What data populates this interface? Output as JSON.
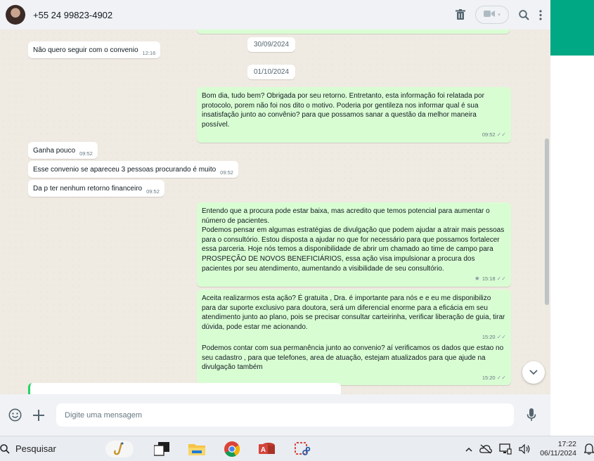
{
  "header": {
    "contact_name": "+55 24 99823-4902"
  },
  "chat": {
    "date_chips": [
      "30/09/2024",
      "01/10/2024"
    ],
    "messages": [
      {
        "dir": "in",
        "text": "Não quero seguir com o convenio",
        "time": "12:16"
      },
      {
        "dir": "out",
        "text": "Bom dia, tudo bem? Obrigada por seu retorno. Entretanto, esta informação foi relatada por protocolo, porem não foi nos dito o motivo. Poderia por gentileza nos informar qual é sua insatisfação junto ao convênio? para que possamos sanar a questão da melhor maneira possível.",
        "time": "09:52"
      },
      {
        "dir": "in",
        "text": "Ganha pouco",
        "time": "09:52"
      },
      {
        "dir": "in",
        "text": "Esse convenio se apareceu 3 pessoas procurando é muito",
        "time": "09:52"
      },
      {
        "dir": "in",
        "text": "Da p ter nenhum retorno financeiro",
        "time": "09:52"
      },
      {
        "dir": "out",
        "text": "Entendo que a procura pode estar baixa, mas acredito que temos potencial para aumentar o número de pacientes.\nPodemos pensar em algumas estratégias de divulgação que podem ajudar a atrair mais pessoas para o consultório. Estou disposta a ajudar no que for necessário para que possamos fortalecer essa parceria. Hoje nós temos a disponibilidade de abrir um chamado ao time de campo para PROSPEÇÃO DE NOVOS  BENEFICIÁRIOS, essa ação visa impulsionar a procura dos pacientes por seu atendimento, aumentando a visibilidade de seu consultório.",
        "time": "15:18",
        "starred": true
      },
      {
        "dir": "out",
        "text": "Aceita realizarmos esta ação? É gratuita , Dra. é importante para nós e e eu me disponibilizo para dar suporte exclusivo para doutora, será um diferencial enorme para a eficácia em seu atendimento junto ao plano, pois se precisar consultar carteirinha, verificar liberação de guia, tirar dúvida, pode estar me acionando.",
        "time": "15:20"
      },
      {
        "dir": "out",
        "text": "Podemos contar com sua permanência junto ao convenio? aí verificamos os dados que estao no seu cadastro , para que telefones, area de atuação, estejam atualizados para que ajude na divulgação também",
        "time": "15:20"
      }
    ]
  },
  "composer": {
    "placeholder": "Digite uma mensagem"
  },
  "taskbar": {
    "search_label": "Pesquisar",
    "time": "17:22",
    "date": "06/11/2024"
  },
  "icons": {
    "header": [
      "trash-icon",
      "video-call-icon",
      "search-icon",
      "menu-icon"
    ],
    "composer": [
      "emoji-icon",
      "attach-plus-icon",
      "mic-icon"
    ]
  },
  "colors": {
    "outgoing_bubble": "#d9fdd3",
    "incoming_bubble": "#ffffff",
    "accent": "#00a884",
    "chat_bg": "#efeae2"
  }
}
